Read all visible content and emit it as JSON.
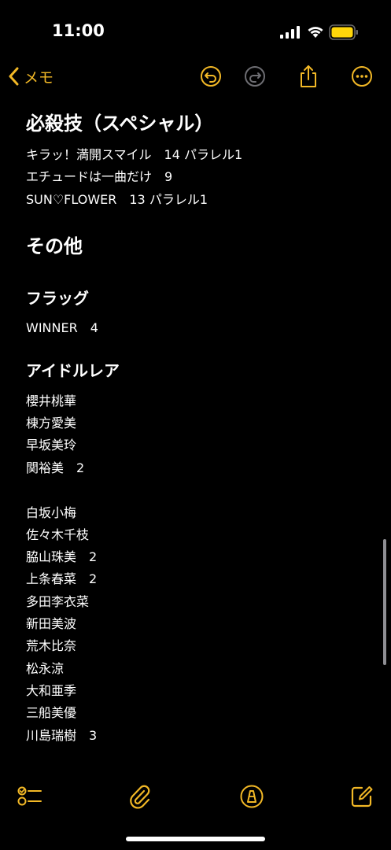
{
  "status_bar": {
    "time": "11:00"
  },
  "nav": {
    "back_label": "メモ"
  },
  "colors": {
    "accent": "#f2b826",
    "background": "#000000",
    "text": "#ffffff",
    "battery": "#ffd60a"
  },
  "note": {
    "special_heading": "必殺技（スペシャル）",
    "special_items": [
      "キラッ！満開スマイル　14 パラレル1",
      "エチュードは一曲だけ　9",
      "SUN♡FLOWER　13 パラレル1"
    ],
    "other_heading": "その他",
    "flag_heading": "フラッグ",
    "flag_items": [
      "WINNER　4"
    ],
    "idol_rare_heading": "アイドルレア",
    "idol_rare_group1": [
      "櫻井桃華",
      "棟方愛美",
      "早坂美玲",
      "関裕美　2"
    ],
    "idol_rare_group2": [
      "白坂小梅",
      "佐々木千枝",
      "脇山珠美　2",
      "上条春菜　2",
      "多田李衣菜",
      "新田美波",
      "荒木比奈",
      "松永涼",
      "大和亜季",
      "三船美優",
      "川島瑞樹　3"
    ]
  },
  "icons": {
    "nav": [
      "chevron-left-icon",
      "undo-icon",
      "redo-icon",
      "share-icon",
      "more-icon"
    ],
    "toolbar": [
      "checklist-icon",
      "paperclip-icon",
      "markup-pen-icon",
      "compose-icon"
    ]
  }
}
